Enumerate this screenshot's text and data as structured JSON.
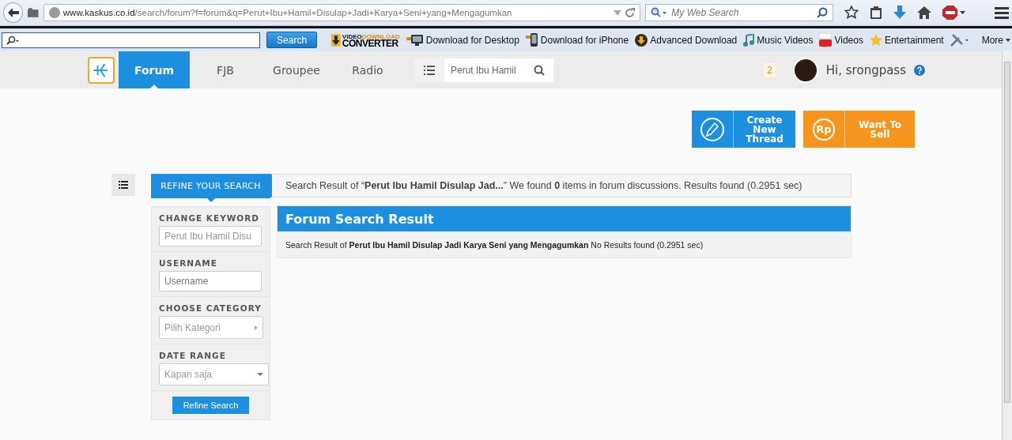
{
  "browser": {
    "url_host": "www.kaskus.co.id",
    "url_path": "/search/forum?f=forum&q=Perut+Ibu+Hamil+Disulap+Jadi+Karya+Seni+yang+Mengagumkan",
    "search_placeholder": "My Web Search"
  },
  "toolbar": {
    "search_button": "Search",
    "logo": [
      "VIDEO",
      "DOWNLOAD",
      "CONVERTER"
    ],
    "links": [
      {
        "label": "Download for Desktop",
        "kind": "desktop"
      },
      {
        "label": "Download for iPhone",
        "kind": "phone"
      },
      {
        "label": "Advanced Download",
        "kind": "download"
      },
      {
        "label": "Music Videos",
        "kind": "music"
      },
      {
        "label": "Videos",
        "kind": "video"
      },
      {
        "label": "Entertainment",
        "kind": "star"
      }
    ],
    "more": "More"
  },
  "nav": {
    "tabs": [
      {
        "label": "Forum",
        "selected": true
      },
      {
        "label": "FJB",
        "selected": false
      },
      {
        "label": "Groupee",
        "selected": false
      },
      {
        "label": "Radio",
        "selected": false
      }
    ],
    "search_value": "Perut Ibu Hamil",
    "notification_count": "2",
    "greeting": "Hi, srongpass"
  },
  "actions": [
    {
      "label": "Create New Thread",
      "kind": "thread"
    },
    {
      "label": "Want To Sell",
      "kind": "sell",
      "icon_text": "Rp"
    }
  ],
  "refine": {
    "header": "REFINE YOUR SEARCH",
    "fields": [
      {
        "label": "CHANGE KEYWORD",
        "kind": "text",
        "value": "Perut Ibu Hamil Disu"
      },
      {
        "label": "USERNAME",
        "kind": "text",
        "placeholder": "Username"
      },
      {
        "label": "CHOOSE CATEGORY",
        "kind": "picker",
        "value": "Pilih Kategori"
      },
      {
        "label": "DATE RANGE",
        "kind": "select",
        "value": "Kapan saja"
      }
    ],
    "button": "Refine Search"
  },
  "summary": "Search Result of “**Perut Ibu Hamil Disulap Jad...**” We found **0** items in forum discussions. Results found (0.2951 sec)",
  "results": {
    "title": "Forum Search Result",
    "message": "Search Result of **Perut Ibu Hamil Disulap Jadi Karya Seni yang Mengagumkan** No Results found (0.2951 sec)"
  }
}
